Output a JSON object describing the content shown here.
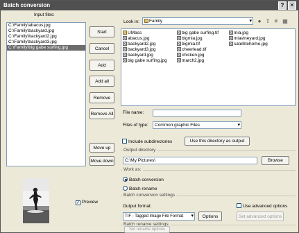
{
  "window": {
    "title": "Batch conversion",
    "help_btn": "?",
    "close_btn": "✕"
  },
  "input": {
    "label": "Input files:",
    "files": [
      "C:\\Family\\abacus.jpg",
      "C:\\Family\\backyard.jpg",
      "C:\\Family\\backyard2.jpg",
      "C:\\Family\\backyard3.jpg",
      "C:\\Family\\big gabe surfing.jpg"
    ],
    "selected_index": 4
  },
  "buttons": {
    "start": "Start",
    "cancel": "Cancel",
    "add": "Add",
    "add_all": "Add all",
    "remove": "Remove",
    "remove_all": "Remove All",
    "move_up": "Move up",
    "move_down": "Move down"
  },
  "browser": {
    "lookin_label": "Look in:",
    "lookin_value": "Family",
    "col1": [
      {
        "name": "UMass",
        "type": "folder"
      },
      {
        "name": "abacus.jpg",
        "type": "img"
      },
      {
        "name": "backyard2.jpg",
        "type": "img"
      },
      {
        "name": "backyard3.jpg",
        "type": "img"
      },
      {
        "name": "backyard.jpg",
        "type": "img"
      },
      {
        "name": "big gabe surfing.jpg",
        "type": "img"
      }
    ],
    "col2": [
      {
        "name": "big gabe surfing.tif",
        "type": "img"
      },
      {
        "name": "bigmia.jpg",
        "type": "img"
      },
      {
        "name": "bigmia.tif",
        "type": "img"
      },
      {
        "name": "cheerlead.tif",
        "type": "img"
      },
      {
        "name": "chicken.jpg",
        "type": "img"
      },
      {
        "name": "march2.jpg",
        "type": "img"
      }
    ],
    "col3": [
      {
        "name": "mia.jpg",
        "type": "img"
      },
      {
        "name": "miavineyard.jpg",
        "type": "img"
      },
      {
        "name": "satellitehome.jpg",
        "type": "img"
      }
    ],
    "filename_label": "File name:",
    "filename_value": "",
    "filetype_label": "Files of type:",
    "filetype_value": "Common graphic Files"
  },
  "options": {
    "include_subdirs": "Include subdirectories",
    "use_dir_btn": "Use this directory as output",
    "output_dir_label": "Output directory",
    "output_dir_value": "C:\\My Pictures\\",
    "browse": "Browse",
    "work_as_label": "Work as:",
    "batch_conversion": "Batch conversion",
    "batch_rename": "Batch rename",
    "conv_settings_label": "Batch conversion settings",
    "output_format_label": "Output format:",
    "output_format_value": "TIF - Tagged Image File Format",
    "options_btn": "Options",
    "use_advanced": "Use advanced options",
    "set_advanced": "Set advanced options",
    "rename_settings_label": "Batch rename settings:",
    "set_rename": "Set rename options",
    "preview": "Preview",
    "preview_checked": "✓"
  }
}
